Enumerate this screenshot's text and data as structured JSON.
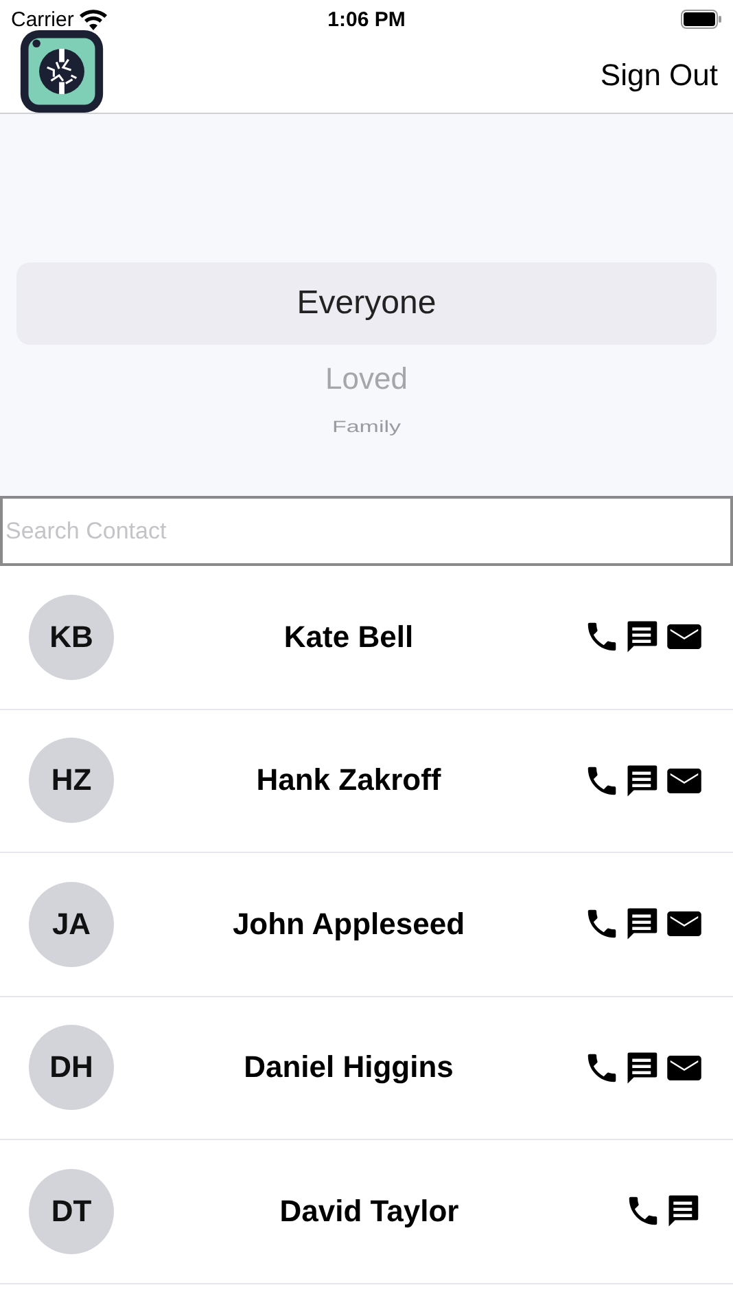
{
  "status_bar": {
    "carrier": "Carrier",
    "time": "1:06 PM"
  },
  "nav": {
    "action": "Sign Out"
  },
  "picker": [
    {
      "label": "Everyone",
      "selected": true
    },
    {
      "label": "Loved",
      "selected": false
    },
    {
      "label": "Family",
      "selected": false
    }
  ],
  "search": {
    "placeholder": "Search Contact"
  },
  "contacts": [
    {
      "initials": "KB",
      "name": "Kate Bell",
      "has_email": true
    },
    {
      "initials": "HZ",
      "name": "Hank Zakroff",
      "has_email": true
    },
    {
      "initials": "JA",
      "name": "John Appleseed",
      "has_email": true
    },
    {
      "initials": "DH",
      "name": "Daniel Higgins",
      "has_email": true
    },
    {
      "initials": "DT",
      "name": "David Taylor",
      "has_email": false
    }
  ]
}
